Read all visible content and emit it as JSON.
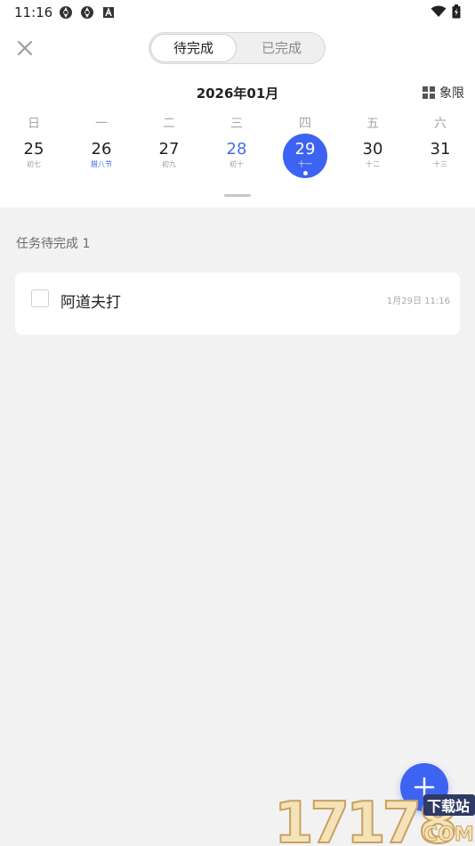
{
  "status_bar": {
    "time": "11:16",
    "icons": [
      "sync-icon",
      "sync-icon",
      "a-icon"
    ],
    "right_icons": [
      "wifi-icon",
      "battery-icon"
    ]
  },
  "header": {
    "close_icon": "close-icon",
    "tabs": [
      {
        "label": "待完成",
        "active": true
      },
      {
        "label": "已完成",
        "active": false
      }
    ]
  },
  "calendar": {
    "month_title": "2026年01月",
    "quadrant_label": "象限",
    "weekdays": [
      "日",
      "一",
      "二",
      "三",
      "四",
      "五",
      "六"
    ],
    "days": [
      {
        "num": "25",
        "lunar": "初七"
      },
      {
        "num": "26",
        "lunar": "腊八节"
      },
      {
        "num": "27",
        "lunar": "初九"
      },
      {
        "num": "28",
        "lunar": "初十"
      },
      {
        "num": "29",
        "lunar": "十一"
      },
      {
        "num": "30",
        "lunar": "十二"
      },
      {
        "num": "31",
        "lunar": "十三"
      }
    ],
    "selected_day": "29",
    "accent_color": "#3d63f2"
  },
  "tasks": {
    "section_title": "任务待完成 1",
    "items": [
      {
        "title": "阿道夫打",
        "time": "1月29日 11:16",
        "done": false
      }
    ]
  },
  "fab": {
    "icon": "plus-icon"
  },
  "watermark": {
    "brand": "17178",
    "domain": "COM",
    "tagline": "下载站"
  }
}
